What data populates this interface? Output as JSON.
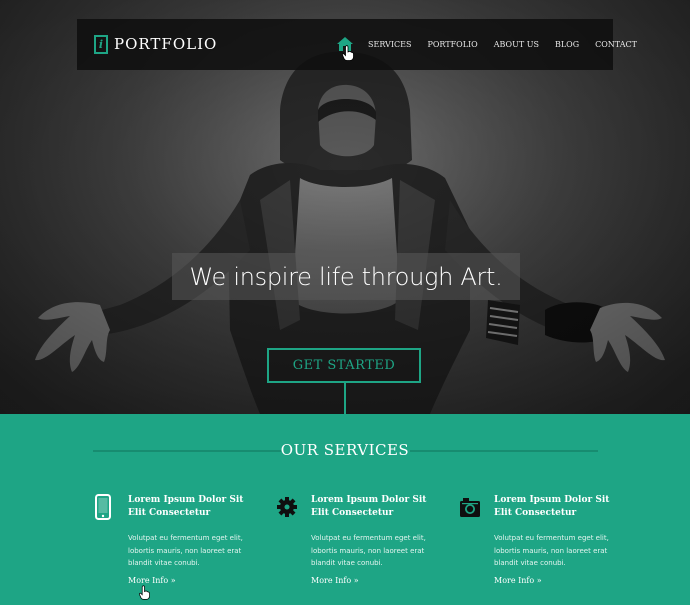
{
  "brand": {
    "logo_letter": "i",
    "name": "PORTFOLIO",
    "accent_color": "#1ea585"
  },
  "nav": {
    "home_icon": "home-icon",
    "items": [
      {
        "label": "SERVICES"
      },
      {
        "label": "PORTFOLIO"
      },
      {
        "label": "ABOUT US"
      },
      {
        "label": "BLOG"
      },
      {
        "label": "CONTACT"
      }
    ]
  },
  "hero": {
    "tagline": "We inspire life through Art.",
    "cta_label": "GET STARTED"
  },
  "services": {
    "title": "OUR SERVICES",
    "items": [
      {
        "icon": "smartphone-icon",
        "heading_line1": "Lorem Ipsum Dolor Sit",
        "heading_line2": "Elit Consectetur",
        "body_line1": "Volutpat eu fermentum eget elit,",
        "body_line2": "lobortis mauris, non laoreet erat",
        "body_line3": "blandit vitae conubi.",
        "more": "More Info »"
      },
      {
        "icon": "gear-icon",
        "heading_line1": "Lorem Ipsum Dolor Sit",
        "heading_line2": "Elit Consectetur",
        "body_line1": "Volutpat eu fermentum eget elit,",
        "body_line2": "lobortis mauris, non laoreet erat",
        "body_line3": "blandit vitae conubi.",
        "more": "More Info »"
      },
      {
        "icon": "camera-icon",
        "heading_line1": "Lorem Ipsum Dolor Sit",
        "heading_line2": "Elit Consectetur",
        "body_line1": "Volutpat eu fermentum eget elit,",
        "body_line2": "lobortis mauris, non laoreet erat",
        "body_line3": "blandit vitae conubi.",
        "more": "More Info »"
      }
    ]
  }
}
